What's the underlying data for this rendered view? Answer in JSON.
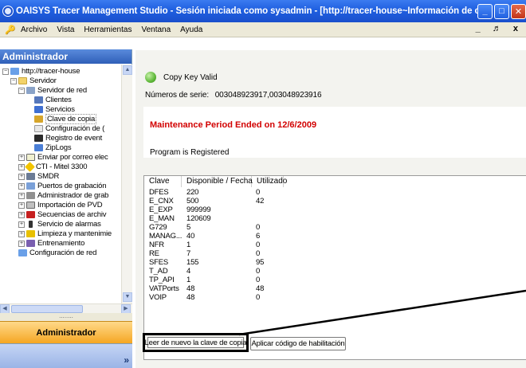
{
  "window": {
    "title": "OAISYS Tracer Management Studio - Sesión iniciada como sysadmin - [http://tracer-house~Información de clave de copia]"
  },
  "menu": {
    "items": [
      "Archivo",
      "Vista",
      "Herramientas",
      "Ventana",
      "Ayuda"
    ],
    "mdi_controls": "_ ♬ x"
  },
  "sidebar": {
    "header": "Administrador",
    "tree": [
      {
        "label": "http://tracer-house"
      },
      {
        "label": "Servidor"
      },
      {
        "label": "Servidor de red"
      },
      {
        "label": "Clientes"
      },
      {
        "label": "Servicios"
      },
      {
        "label": "Clave de copia"
      },
      {
        "label": "Configuración de ("
      },
      {
        "label": "Registro de event"
      },
      {
        "label": "ZipLogs"
      },
      {
        "label": "Enviar por correo elec"
      },
      {
        "label": "CTI - Mitel 3300"
      },
      {
        "label": "SMDR"
      },
      {
        "label": "Puertos de grabación"
      },
      {
        "label": "Administrador de grab"
      },
      {
        "label": "Importación de PVD"
      },
      {
        "label": "Secuencias de archiv"
      },
      {
        "label": "Servicio de alarmas"
      },
      {
        "label": "Limpieza y mantenimie"
      },
      {
        "label": "Entrenamiento"
      },
      {
        "label": "Configuración de red"
      }
    ],
    "grip": "........",
    "admin_button": "Administrador",
    "chevron": "»"
  },
  "main": {
    "status": "Copy Key Valid",
    "serial_label": "Números de serie:",
    "serial_value": "003048923917,003048923916",
    "maintenance": "Maintenance Period Ended on 12/6/2009",
    "registered": "Program is Registered",
    "table": {
      "headers": [
        "Clave",
        "Disponible / Fecha",
        "Utilizado"
      ],
      "rows": [
        [
          "DFES",
          "220",
          "0"
        ],
        [
          "E_CNX",
          "500",
          "42"
        ],
        [
          "E_EXP",
          "999999",
          ""
        ],
        [
          "E_MAN",
          "120609",
          ""
        ],
        [
          "G729",
          "5",
          "0"
        ],
        [
          "MANAG...",
          "40",
          "6"
        ],
        [
          "NFR",
          "1",
          "0"
        ],
        [
          "RE",
          "7",
          "0"
        ],
        [
          "SFES",
          "155",
          "95"
        ],
        [
          "T_AD",
          "4",
          "0"
        ],
        [
          "TP_API",
          "1",
          "0"
        ],
        [
          "VATPorts",
          "48",
          "48"
        ],
        [
          "VOIP",
          "48",
          "0"
        ]
      ]
    },
    "reread_button": "Leer de nuevo la clave de copia",
    "apply_button": "Aplicar código de habilitación"
  }
}
